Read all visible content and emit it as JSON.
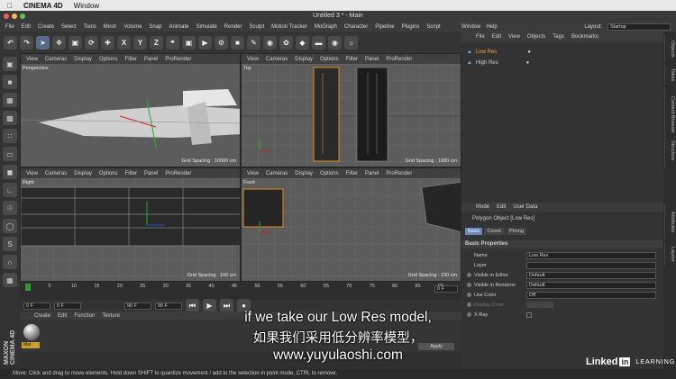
{
  "mac": {
    "app": "CINEMA 4D",
    "menu": "Window"
  },
  "window": {
    "title": "Untitled 3 * - Main"
  },
  "menu": [
    "File",
    "Edit",
    "Create",
    "Select",
    "Tools",
    "Mesh",
    "Volume",
    "Snap",
    "Animate",
    "Simulate",
    "Render",
    "Sculpt",
    "Motion Tracker",
    "MoGraph",
    "Character",
    "Pipeline",
    "Plugins",
    "Script",
    "Window",
    "Help"
  ],
  "layout": {
    "label": "Layout:",
    "value": "Startup"
  },
  "viewport_menu": [
    "View",
    "Cameras",
    "Display",
    "Options",
    "Filter",
    "Panel",
    "ProRender"
  ],
  "viewports": [
    {
      "name": "Perspective",
      "grid": "Grid Spacing : 10000 cm"
    },
    {
      "name": "Top",
      "grid": "Grid Spacing : 1000 cm"
    },
    {
      "name": "Right",
      "grid": "Grid Spacing : 100 cm"
    },
    {
      "name": "Front",
      "grid": "Grid Spacing : 100 cm"
    }
  ],
  "timeline": {
    "ticks": [
      "0",
      "5",
      "10",
      "15",
      "20",
      "25",
      "30",
      "35",
      "40",
      "45",
      "50",
      "55",
      "60",
      "65",
      "70",
      "75",
      "80",
      "85",
      "90"
    ],
    "end": "0 F",
    "start_field": "0 F",
    "min_field": "0 F",
    "max_field": "90 F",
    "max_field2": "90 F"
  },
  "material": {
    "menu": [
      "Create",
      "Edit",
      "Function",
      "Texture"
    ],
    "name": "Mat",
    "apply": "Apply"
  },
  "status": "Move: Click and drag to move elements. Hold down SHIFT to quantize movement / add to the selection in point mode, CTRL to remove.",
  "objects": {
    "menu": [
      "File",
      "Edit",
      "View",
      "Objects",
      "Tags",
      "Bookmarks"
    ],
    "items": [
      "Low Res",
      "High Res"
    ]
  },
  "side_tabs": [
    "Objects",
    "Takes",
    "Content Browser",
    "Structure",
    "Attributes",
    "Layers"
  ],
  "attributes": {
    "menu": [
      "Mode",
      "Edit",
      "User Data"
    ],
    "title": "Polygon Object [Low Res]",
    "tabs": [
      "Basic",
      "Coord.",
      "Phong"
    ],
    "section": "Basic Properties",
    "rows": [
      {
        "label": "Name",
        "value": "Low Res"
      },
      {
        "label": "Layer",
        "value": ""
      },
      {
        "label": "Visible in Editor",
        "value": "Default"
      },
      {
        "label": "Visible in Renderer",
        "value": "Default"
      },
      {
        "label": "Use Color",
        "value": "Off"
      },
      {
        "label": "Display Color",
        "value": ""
      },
      {
        "label": "X-Ray",
        "value": ""
      }
    ]
  },
  "subtitles": {
    "en": "if we take our Low Res model,",
    "zh": "如果我们采用低分辨率模型，",
    "url": "www.yuyulaoshi.com"
  },
  "brand": {
    "linked": "Linked",
    "in": "in",
    "learning": "LEARNING"
  }
}
